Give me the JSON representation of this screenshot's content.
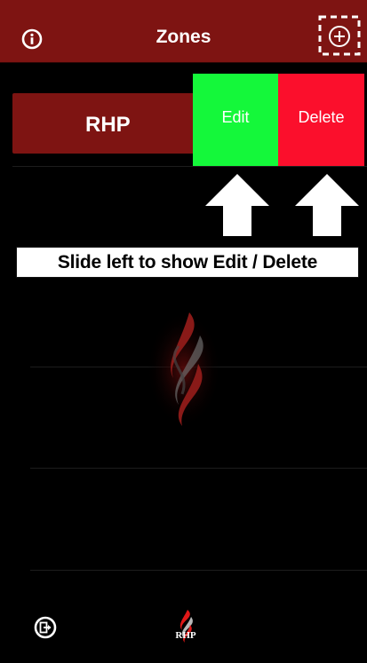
{
  "navbar": {
    "title": "Zones",
    "info_icon": "info-icon",
    "add_icon": "add-zone-icon"
  },
  "zones": [
    {
      "name": "RHP",
      "edit_label": "Edit",
      "delete_label": "Delete"
    }
  ],
  "hint": {
    "text": "Slide left to show Edit / Delete"
  },
  "footer": {
    "logo_text": "RHP",
    "exit_icon": "exit-icon"
  },
  "colors": {
    "navbar": "#7e1412",
    "zone_card": "#7e1412",
    "edit": "#14f83a",
    "delete": "#fb0f2c",
    "background": "#000000"
  }
}
